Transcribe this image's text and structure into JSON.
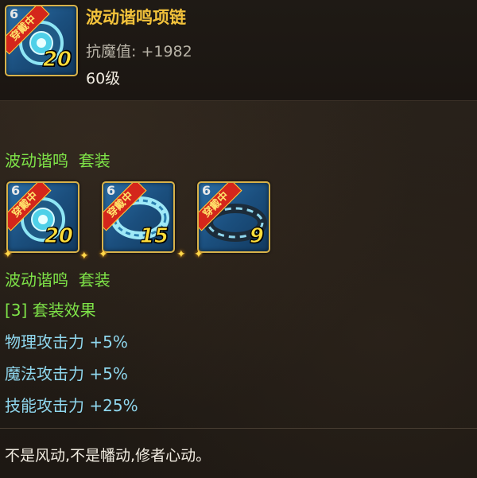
{
  "item": {
    "name": "波动谐鸣项链",
    "stat_label": "抗魔值:",
    "stat_value": "+1982",
    "level_text": "60级",
    "icon_level": "20",
    "icon_tag": "穿戴中",
    "icon_name": "necklace-icon"
  },
  "set_section": {
    "title_name": "波动谐鸣",
    "title_suffix": "套装",
    "pieces": [
      {
        "icon": "necklace-icon",
        "level": "20",
        "tag": "穿戴中"
      },
      {
        "icon": "bracelet-icon",
        "level": "15",
        "tag": "穿戴中"
      },
      {
        "icon": "ring-icon",
        "level": "9",
        "tag": "穿戴中"
      }
    ],
    "subtitle_name": "波动谐鸣",
    "subtitle_suffix": "套装",
    "effect_header": "[3] 套装效果",
    "effects": [
      "物理攻击力 +5%",
      "魔法攻击力 +5%",
      "技能攻击力 +25%"
    ]
  },
  "flavor_text": "不是风动,不是幡动,修者心动。",
  "colors": {
    "title": "#f2c23b",
    "set_name": "#7ee348",
    "effect": "#8fd7ee",
    "frame": "#d8b24a"
  }
}
